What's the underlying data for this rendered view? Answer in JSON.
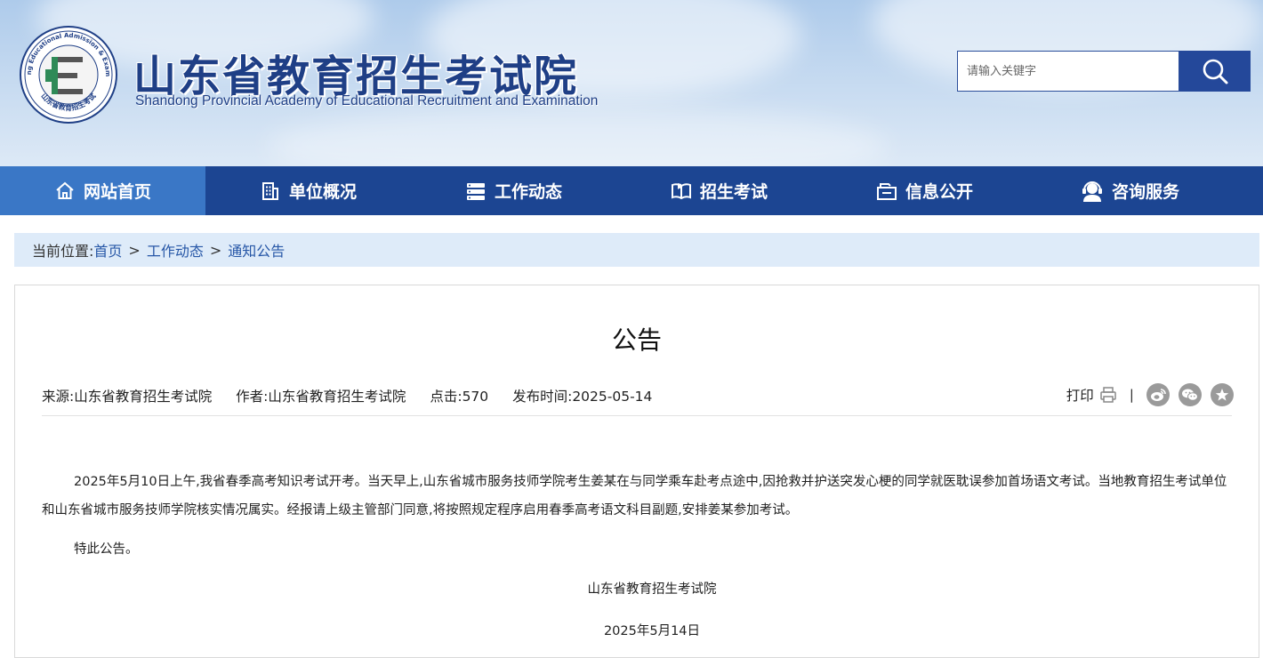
{
  "header": {
    "title": "山东省教育招生考试院",
    "subtitle": "Shandong Provincial Academy of Educational Recruitment and Examination",
    "emblem_letter": "E",
    "emblem_ring_text": "Shandong Educational Admission & Examination",
    "emblem_bottom_text": "山东省教育招生考试",
    "search_placeholder": "请输入关键字",
    "search_icon": "magnifier-icon"
  },
  "nav": {
    "items": [
      {
        "label": "网站首页",
        "icon": "home-icon",
        "active": true
      },
      {
        "label": "单位概况",
        "icon": "building-icon",
        "active": false
      },
      {
        "label": "工作动态",
        "icon": "list-icon",
        "active": false
      },
      {
        "label": "招生考试",
        "icon": "book-icon",
        "active": false
      },
      {
        "label": "信息公开",
        "icon": "folder-icon",
        "active": false
      },
      {
        "label": "咨询服务",
        "icon": "headset-icon",
        "active": false
      }
    ]
  },
  "breadcrumb": {
    "prefix": "当前位置:",
    "items": [
      "首页",
      "工作动态",
      "通知公告"
    ],
    "separator": ">"
  },
  "article": {
    "title": "公告",
    "source": "来源:山东省教育招生考试院",
    "author": "作者:山东省教育招生考试院",
    "clicks": "点击:570",
    "published": "发布时间:2025-05-14",
    "print_label": "打印",
    "divider": "|",
    "paragraphs": [
      "2025年5月10日上午,我省春季高考知识考试开考。当天早上,山东省城市服务技师学院考生姜某在与同学乘车赴考点途中,因抢救并护送突发心梗的同学就医耽误参加首场语文考试。当地教育招生考试单位和山东省城市服务技师学院核实情况属实。经报请上级主管部门同意,将按照规定程序启用春季高考语文科目副题,安排姜某参加考试。",
      "特此公告。"
    ],
    "signature": "山东省教育招生考试院",
    "date": "2025年5月14日"
  },
  "colors": {
    "nav_bg": "#1c4592",
    "nav_active": "#3a77c6",
    "brand_blue": "#1f3f86",
    "breadcrumb_bg": "#deebf9",
    "link": "#2757a7",
    "emblem_green": "#2e8a57"
  }
}
